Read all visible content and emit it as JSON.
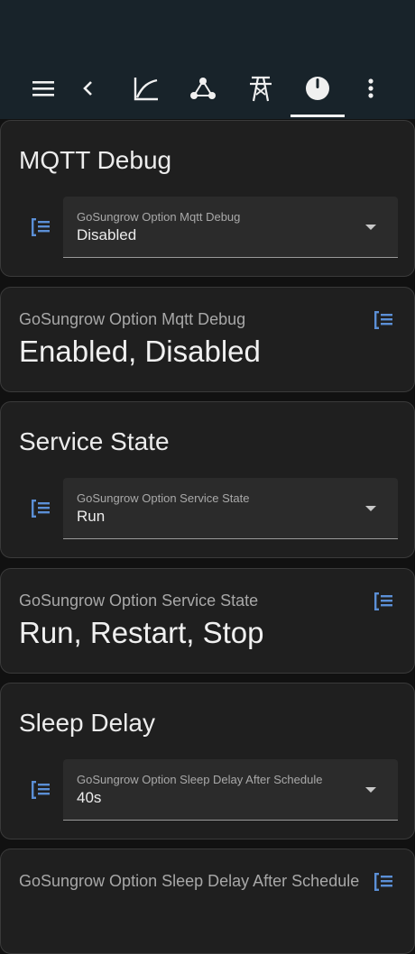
{
  "toolbar": {
    "icons": [
      "menu-icon",
      "back-chevron-icon",
      "chart-line-icon",
      "graph-nodes-icon",
      "transmission-tower-icon",
      "gauge-icon",
      "more-vert-icon"
    ]
  },
  "cards": [
    {
      "type": "select",
      "title": "MQTT Debug",
      "label": "GoSungrow Option Mqtt Debug",
      "value": "Disabled"
    },
    {
      "type": "info",
      "label": "GoSungrow Option Mqtt Debug",
      "value": "Enabled, Disabled"
    },
    {
      "type": "select",
      "title": "Service State",
      "label": "GoSungrow Option Service State",
      "value": "Run"
    },
    {
      "type": "info",
      "label": "GoSungrow Option Service State",
      "value": "Run, Restart, Stop"
    },
    {
      "type": "select",
      "title": "Sleep Delay",
      "label": "GoSungrow Option Sleep Delay After Schedule",
      "value": "40s"
    },
    {
      "type": "info",
      "label": "GoSungrow Option Sleep Delay After Schedule",
      "value": ""
    }
  ],
  "colors": {
    "topbar": "#18232a",
    "card_bg": "#1f1f1f",
    "accent_icon": "#5b8fd6"
  }
}
